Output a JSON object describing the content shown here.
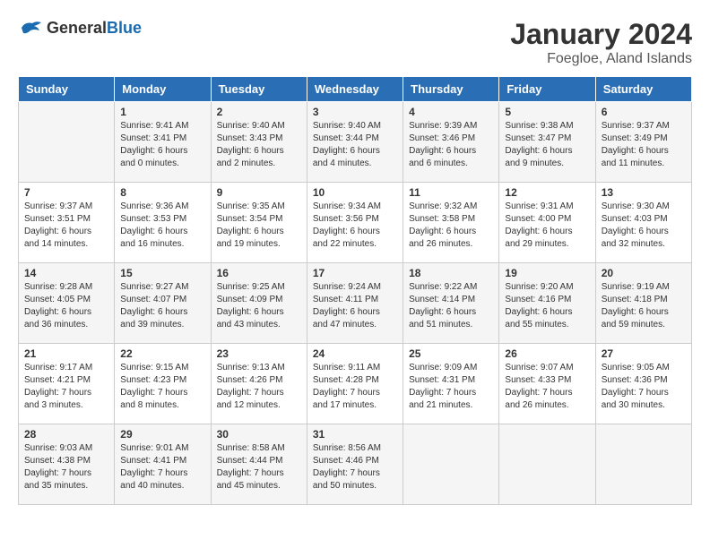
{
  "header": {
    "logo_general": "General",
    "logo_blue": "Blue",
    "month_title": "January 2024",
    "location": "Foegloe, Aland Islands"
  },
  "weekdays": [
    "Sunday",
    "Monday",
    "Tuesday",
    "Wednesday",
    "Thursday",
    "Friday",
    "Saturday"
  ],
  "weeks": [
    [
      {
        "day": "",
        "info": ""
      },
      {
        "day": "1",
        "info": "Sunrise: 9:41 AM\nSunset: 3:41 PM\nDaylight: 6 hours\nand 0 minutes."
      },
      {
        "day": "2",
        "info": "Sunrise: 9:40 AM\nSunset: 3:43 PM\nDaylight: 6 hours\nand 2 minutes."
      },
      {
        "day": "3",
        "info": "Sunrise: 9:40 AM\nSunset: 3:44 PM\nDaylight: 6 hours\nand 4 minutes."
      },
      {
        "day": "4",
        "info": "Sunrise: 9:39 AM\nSunset: 3:46 PM\nDaylight: 6 hours\nand 6 minutes."
      },
      {
        "day": "5",
        "info": "Sunrise: 9:38 AM\nSunset: 3:47 PM\nDaylight: 6 hours\nand 9 minutes."
      },
      {
        "day": "6",
        "info": "Sunrise: 9:37 AM\nSunset: 3:49 PM\nDaylight: 6 hours\nand 11 minutes."
      }
    ],
    [
      {
        "day": "7",
        "info": "Sunrise: 9:37 AM\nSunset: 3:51 PM\nDaylight: 6 hours\nand 14 minutes."
      },
      {
        "day": "8",
        "info": "Sunrise: 9:36 AM\nSunset: 3:53 PM\nDaylight: 6 hours\nand 16 minutes."
      },
      {
        "day": "9",
        "info": "Sunrise: 9:35 AM\nSunset: 3:54 PM\nDaylight: 6 hours\nand 19 minutes."
      },
      {
        "day": "10",
        "info": "Sunrise: 9:34 AM\nSunset: 3:56 PM\nDaylight: 6 hours\nand 22 minutes."
      },
      {
        "day": "11",
        "info": "Sunrise: 9:32 AM\nSunset: 3:58 PM\nDaylight: 6 hours\nand 26 minutes."
      },
      {
        "day": "12",
        "info": "Sunrise: 9:31 AM\nSunset: 4:00 PM\nDaylight: 6 hours\nand 29 minutes."
      },
      {
        "day": "13",
        "info": "Sunrise: 9:30 AM\nSunset: 4:03 PM\nDaylight: 6 hours\nand 32 minutes."
      }
    ],
    [
      {
        "day": "14",
        "info": "Sunrise: 9:28 AM\nSunset: 4:05 PM\nDaylight: 6 hours\nand 36 minutes."
      },
      {
        "day": "15",
        "info": "Sunrise: 9:27 AM\nSunset: 4:07 PM\nDaylight: 6 hours\nand 39 minutes."
      },
      {
        "day": "16",
        "info": "Sunrise: 9:25 AM\nSunset: 4:09 PM\nDaylight: 6 hours\nand 43 minutes."
      },
      {
        "day": "17",
        "info": "Sunrise: 9:24 AM\nSunset: 4:11 PM\nDaylight: 6 hours\nand 47 minutes."
      },
      {
        "day": "18",
        "info": "Sunrise: 9:22 AM\nSunset: 4:14 PM\nDaylight: 6 hours\nand 51 minutes."
      },
      {
        "day": "19",
        "info": "Sunrise: 9:20 AM\nSunset: 4:16 PM\nDaylight: 6 hours\nand 55 minutes."
      },
      {
        "day": "20",
        "info": "Sunrise: 9:19 AM\nSunset: 4:18 PM\nDaylight: 6 hours\nand 59 minutes."
      }
    ],
    [
      {
        "day": "21",
        "info": "Sunrise: 9:17 AM\nSunset: 4:21 PM\nDaylight: 7 hours\nand 3 minutes."
      },
      {
        "day": "22",
        "info": "Sunrise: 9:15 AM\nSunset: 4:23 PM\nDaylight: 7 hours\nand 8 minutes."
      },
      {
        "day": "23",
        "info": "Sunrise: 9:13 AM\nSunset: 4:26 PM\nDaylight: 7 hours\nand 12 minutes."
      },
      {
        "day": "24",
        "info": "Sunrise: 9:11 AM\nSunset: 4:28 PM\nDaylight: 7 hours\nand 17 minutes."
      },
      {
        "day": "25",
        "info": "Sunrise: 9:09 AM\nSunset: 4:31 PM\nDaylight: 7 hours\nand 21 minutes."
      },
      {
        "day": "26",
        "info": "Sunrise: 9:07 AM\nSunset: 4:33 PM\nDaylight: 7 hours\nand 26 minutes."
      },
      {
        "day": "27",
        "info": "Sunrise: 9:05 AM\nSunset: 4:36 PM\nDaylight: 7 hours\nand 30 minutes."
      }
    ],
    [
      {
        "day": "28",
        "info": "Sunrise: 9:03 AM\nSunset: 4:38 PM\nDaylight: 7 hours\nand 35 minutes."
      },
      {
        "day": "29",
        "info": "Sunrise: 9:01 AM\nSunset: 4:41 PM\nDaylight: 7 hours\nand 40 minutes."
      },
      {
        "day": "30",
        "info": "Sunrise: 8:58 AM\nSunset: 4:44 PM\nDaylight: 7 hours\nand 45 minutes."
      },
      {
        "day": "31",
        "info": "Sunrise: 8:56 AM\nSunset: 4:46 PM\nDaylight: 7 hours\nand 50 minutes."
      },
      {
        "day": "",
        "info": ""
      },
      {
        "day": "",
        "info": ""
      },
      {
        "day": "",
        "info": ""
      }
    ]
  ]
}
